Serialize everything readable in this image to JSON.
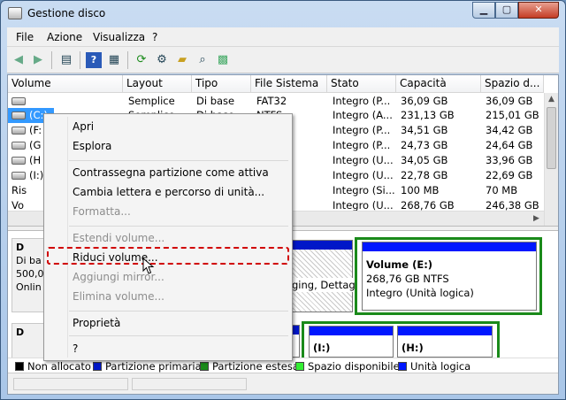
{
  "window": {
    "title": "Gestione disco"
  },
  "menu": [
    "File",
    "Azione",
    "Visualizza",
    "?"
  ],
  "toolbar": {
    "icons": [
      "back-arrow-icon",
      "forward-arrow-icon",
      "show-hide-console-tree-icon",
      "help-icon",
      "properties-icon",
      "refresh-icon",
      "rescan-icon",
      "open-folder-icon",
      "search-icon",
      "export-list-icon"
    ]
  },
  "volume_table": {
    "columns": [
      "Volume",
      "Layout",
      "Tipo",
      "File Sistema",
      "Stato",
      "Capacità",
      "Spazio d..."
    ],
    "rows": [
      {
        "volume": "",
        "layout": "Semplice",
        "tipo": "Di base",
        "fs": "FAT32",
        "stato": "Integro (P...",
        "capacita": "36,09 GB",
        "spazio": "36,09 GB"
      },
      {
        "volume": "(C:)",
        "layout": "Semplice",
        "tipo": "Di base",
        "fs": "NTFS",
        "stato": "Integro (A...",
        "capacita": "231,13 GB",
        "spazio": "215,01 GB"
      },
      {
        "volume": "(F:",
        "layout": "",
        "tipo": "",
        "fs": "",
        "stato": "Integro (P...",
        "capacita": "34,51 GB",
        "spazio": "34,42 GB"
      },
      {
        "volume": "(G",
        "layout": "",
        "tipo": "",
        "fs": "",
        "stato": "Integro (P...",
        "capacita": "24,73 GB",
        "spazio": "24,64 GB"
      },
      {
        "volume": "(H",
        "layout": "",
        "tipo": "",
        "fs": "",
        "stato": "Integro (U...",
        "capacita": "34,05 GB",
        "spazio": "33,96 GB"
      },
      {
        "volume": "(I:)",
        "layout": "",
        "tipo": "",
        "fs": "",
        "stato": "Integro (U...",
        "capacita": "22,78 GB",
        "spazio": "22,69 GB"
      },
      {
        "volume": "Ris",
        "layout": "",
        "tipo": "",
        "fs": "",
        "stato": "Integro (Si...",
        "capacita": "100 MB",
        "spazio": "70 MB"
      },
      {
        "volume": "Vo",
        "layout": "",
        "tipo": "",
        "fs": "",
        "stato": "Integro (U...",
        "capacita": "268,76 GB",
        "spazio": "246,38 GB"
      }
    ]
  },
  "disk_pane": {
    "disk1": {
      "label": "D",
      "line1": "Di ba",
      "line2": "500,0",
      "line3": "Onlin"
    },
    "disk2": {
      "label": "D"
    },
    "partition_text_fragment": "ging, Dettag",
    "volume_e": {
      "name": "Volume  (E:)",
      "size": "268,76 GB NTFS",
      "status": "Integro (Unità logica)"
    },
    "part_i": "(I:)",
    "part_h": "(H:)"
  },
  "legend": [
    {
      "label": "Non allocato",
      "color": "#000000"
    },
    {
      "label": "Partizione primaria",
      "color": "#0017c8"
    },
    {
      "label": "Partizione estesa",
      "color": "#1a8a1a"
    },
    {
      "label": "Spazio disponibile",
      "color": "#33ee33"
    },
    {
      "label": "Unità logica",
      "color": "#0017ff"
    }
  ],
  "context_menu": {
    "items": [
      {
        "label": "Apri",
        "enabled": true
      },
      {
        "label": "Esplora",
        "enabled": true
      },
      {
        "label": "Contrassegna partizione come attiva",
        "enabled": true
      },
      {
        "label": "Cambia lettera e percorso di unità...",
        "enabled": true
      },
      {
        "label": "Formatta...",
        "enabled": false
      },
      {
        "label": "Estendi volume...",
        "enabled": false
      },
      {
        "label": "Riduci volume...",
        "enabled": true,
        "highlighted": true
      },
      {
        "label": "Aggiungi mirror...",
        "enabled": false
      },
      {
        "label": "Elimina volume...",
        "enabled": false
      },
      {
        "label": "Proprietà",
        "enabled": true
      },
      {
        "label": "?",
        "enabled": true
      }
    ]
  },
  "colors": {
    "primary_partition": "#0017c8",
    "extended_partition": "#1a8a1a",
    "highlight_outline": "#d00000"
  }
}
